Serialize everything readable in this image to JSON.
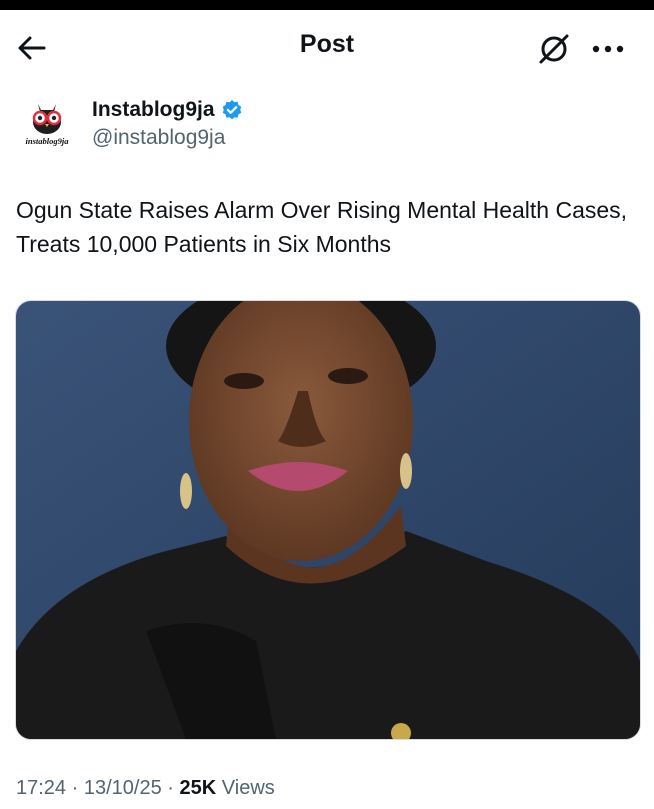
{
  "header": {
    "title": "Post",
    "back_icon": "arrow-left-icon",
    "grok_icon": "grok-icon",
    "more_icon": "more-horizontal-icon"
  },
  "author": {
    "display_name": "Instablog9ja",
    "handle": "@instablog9ja",
    "avatar_text": "instablog9ja",
    "verified_color": "#1d9bf0"
  },
  "tweet": {
    "text": "Ogun State Raises Alarm Over Rising Mental Health Cases, Treats 10,000 Patients in Six Months"
  },
  "meta": {
    "time": "17:24",
    "separator": "·",
    "date": "13/10/25",
    "views_count": "25K",
    "views_label": "Views"
  }
}
